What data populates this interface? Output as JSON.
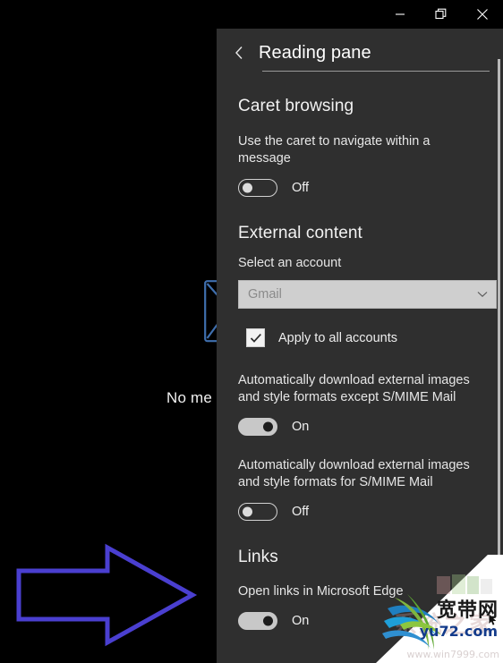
{
  "window": {
    "controls": [
      {
        "name": "minimize",
        "icon": "minimize-icon",
        "label": "Minimize"
      },
      {
        "name": "restore",
        "icon": "restore-icon",
        "label": "Restore Down"
      },
      {
        "name": "close",
        "icon": "close-icon",
        "label": "Close"
      }
    ]
  },
  "background": {
    "empty_state_text": "No me",
    "envelope_icon": "envelope-icon",
    "arrow_annotation_icon": "right-arrow-annotation-icon",
    "arrow_color": "#4a3fd0"
  },
  "panel": {
    "back_icon": "chevron-left-icon",
    "title": "Reading pane",
    "sections": [
      {
        "id": "caret-browsing",
        "heading": "Caret browsing",
        "setting_label": "Use the caret to navigate within a message",
        "toggle": {
          "state": "Off",
          "on": false
        }
      },
      {
        "id": "external-content",
        "heading": "External content",
        "account_label": "Select an account",
        "account_value": "Gmail",
        "account_chevron_icon": "chevron-down-icon",
        "checkbox": {
          "label": "Apply to all accounts",
          "checked": true,
          "icon": "checkmark-icon"
        },
        "toggles": [
          {
            "label": "Automatically download external images and style formats except S/MIME Mail",
            "state": "On",
            "on": true
          },
          {
            "label": "Automatically download external images and style formats for S/MIME Mail",
            "state": "Off",
            "on": false
          }
        ]
      },
      {
        "id": "links",
        "heading": "Links",
        "setting_label": "Open links in Microsoft Edge",
        "toggle": {
          "state": "On",
          "on": true
        }
      }
    ]
  },
  "watermark": {
    "logo_icon": "swoosh-globe-logo-icon",
    "chinese_text": "宽带网",
    "url": "yu72.com",
    "faint_chinese_text": "系统之家",
    "faint_url": "www.win7999.com"
  },
  "colors": {
    "panel_background": "#2f2f2f",
    "app_background": "#000000",
    "dropdown_background": "#cfcfcf",
    "toggle_on": "#c8c8c8",
    "accent_blue": "#123a8a"
  }
}
